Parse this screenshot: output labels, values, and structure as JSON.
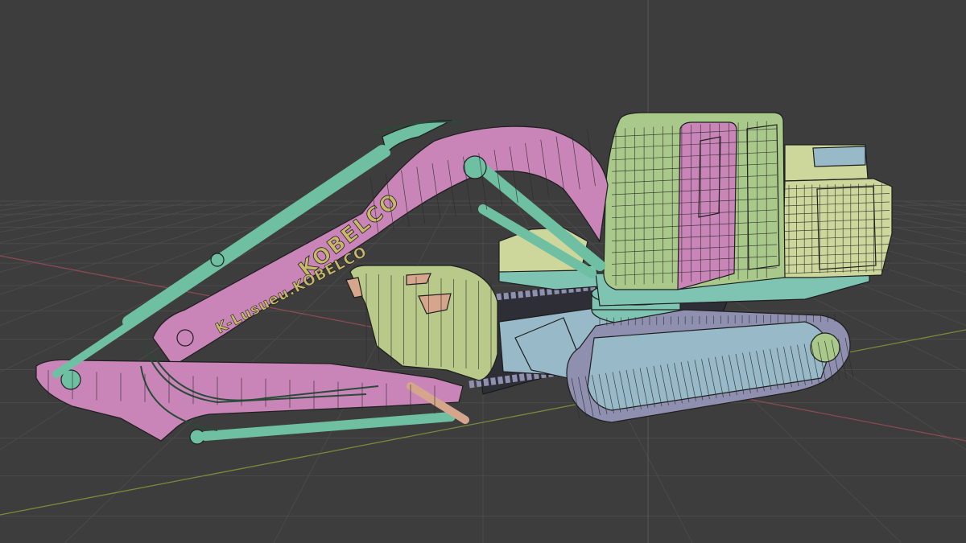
{
  "viewport": {
    "mode": "3d-wireframe-solid",
    "background_color": "#3d3d3d",
    "grid_color": "#4a4a4a",
    "axis_x_color": "#8a4a52",
    "axis_y_color": "#7a8a3a",
    "axis_z_color": "#5a5a5a"
  },
  "model": {
    "boom_text": "KOBELCO",
    "arm_text": "K-Lusueu.KOBELCO",
    "colors": {
      "boom": "#c985b8",
      "cylinders": "#6fc0a3",
      "cab": "#a9c98a",
      "cab_door": "#c985b8",
      "engine": "#cdd79b",
      "tracks": "#8f8fb0",
      "undercarriage": "#98b9c8",
      "bucket": "#b9c98a",
      "bucket_teeth": "#d6a68c",
      "turntable": "#7fc4b3"
    }
  }
}
